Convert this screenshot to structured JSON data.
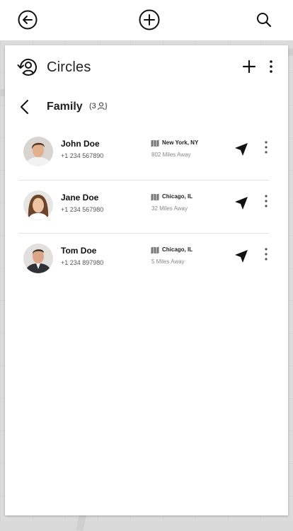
{
  "top_bar": {
    "back_icon": "circle-arrow-left-icon",
    "add_icon": "circle-plus-icon",
    "search_icon": "search-icon"
  },
  "panel": {
    "title": "Circles",
    "title_icon": "circle-user-refresh-icon"
  },
  "group": {
    "name": "Family",
    "count": "(3"
  },
  "members": [
    {
      "name": "John Doe",
      "phone": "+1 234 567890",
      "city": "New York, NY",
      "distance": "802 Miles Away"
    },
    {
      "name": "Jane Doe",
      "phone": "+1 234 567980",
      "city": "Chicago, IL",
      "distance": "32 Miles Away"
    },
    {
      "name": "Tom Doe",
      "phone": "+1 234 897980",
      "city": "Chicago, IL",
      "distance": "5 Miles Away"
    }
  ]
}
